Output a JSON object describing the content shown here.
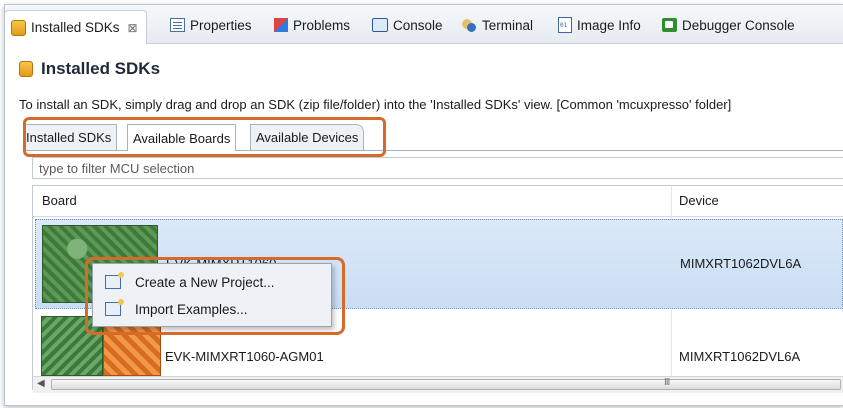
{
  "view_tabs": [
    {
      "label": "Installed SDKs",
      "icon": "sdk-icon",
      "close": "⊠"
    },
    {
      "label": "Properties",
      "icon": "properties-icon"
    },
    {
      "label": "Problems",
      "icon": "problems-icon"
    },
    {
      "label": "Console",
      "icon": "console-icon"
    },
    {
      "label": "Terminal",
      "icon": "terminal-icon"
    },
    {
      "label": "Image Info",
      "icon": "image-info-icon"
    },
    {
      "label": "Debugger Console",
      "icon": "debugger-console-icon"
    }
  ],
  "title": "Installed SDKs",
  "instruction": "To install an SDK, simply drag and drop an SDK (zip file/folder) into the 'Installed SDKs' view. [Common 'mcuxpresso' folder]",
  "sdk_tabs": [
    "Installed SDKs",
    "Available Boards",
    "Available Devices"
  ],
  "filter_placeholder": "type to filter MCU selection",
  "table": {
    "headers": {
      "board": "Board",
      "device": "Device"
    },
    "rows": [
      {
        "board": "EVK-MIMXRT1060",
        "device": "MIMXRT1062DVL6A"
      },
      {
        "board": "EVK-MIMXRT1060-AGM01",
        "device": "MIMXRT1062DVL6A"
      }
    ]
  },
  "context_menu": [
    "Create a New Project...",
    "Import Examples..."
  ],
  "scrollbar": {
    "grip": "III"
  },
  "colors": {
    "callout": "#d56a2a",
    "selection": "#c9ddf3"
  }
}
